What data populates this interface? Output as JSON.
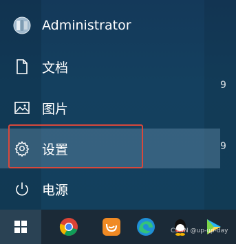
{
  "user": {
    "name": "Administrator"
  },
  "menu": {
    "documents_label": "文档",
    "pictures_label": "图片",
    "settings_label": "设置",
    "power_label": "电源"
  },
  "tiles": {
    "partial_text_1": "9",
    "partial_text_2": "9"
  },
  "taskbar": {
    "apps": [
      "chrome-icon",
      "uc-browser-icon",
      "edge-icon",
      "qq-icon",
      "media-player-icon"
    ]
  },
  "watermark": {
    "text": "CSDN @up-up-day"
  },
  "colors": {
    "highlight_border": "#d9483b",
    "panel_bg": "#143b5a",
    "taskbar_bg": "#1b2a37"
  }
}
